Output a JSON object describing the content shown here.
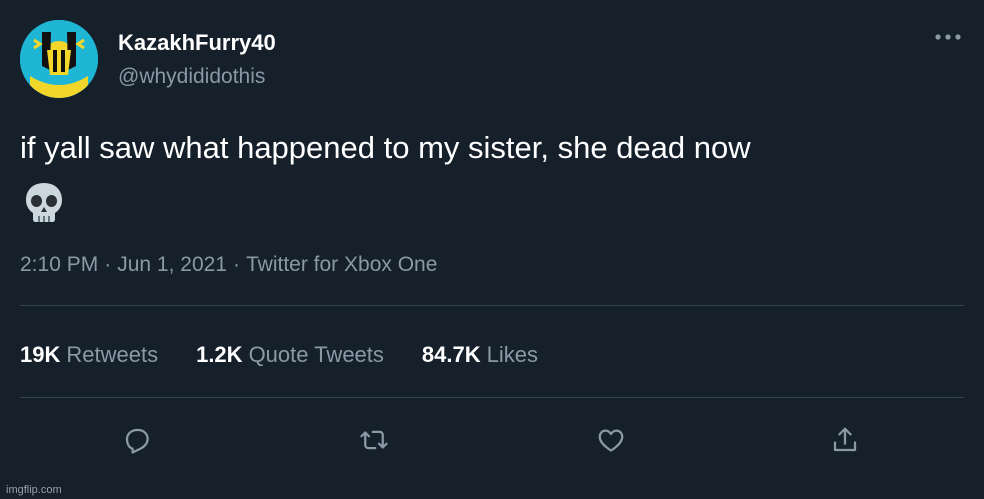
{
  "user": {
    "display_name": "KazakhFurry40",
    "handle": "@whydididothis",
    "avatar_icon": "kazakh-flag-mask-avatar"
  },
  "tweet": {
    "text": "if yall saw what happened to my sister, she dead now",
    "emoji_icon": "skull-emoji",
    "time": "2:10 PM",
    "date": "Jun 1, 2021",
    "source": "Twitter for Xbox One",
    "separator": "·"
  },
  "stats": {
    "retweets": {
      "count": "19K",
      "label": "Retweets"
    },
    "quote_tweets": {
      "count": "1.2K",
      "label": "Quote Tweets"
    },
    "likes": {
      "count": "84.7K",
      "label": "Likes"
    }
  },
  "actions": [
    "reply-icon",
    "retweet-icon",
    "like-icon",
    "share-icon"
  ],
  "watermark": "imgflip.com",
  "colors": {
    "background": "#15202b",
    "text": "#ffffff",
    "secondary": "#8b98a5",
    "divider": "#38444d"
  }
}
